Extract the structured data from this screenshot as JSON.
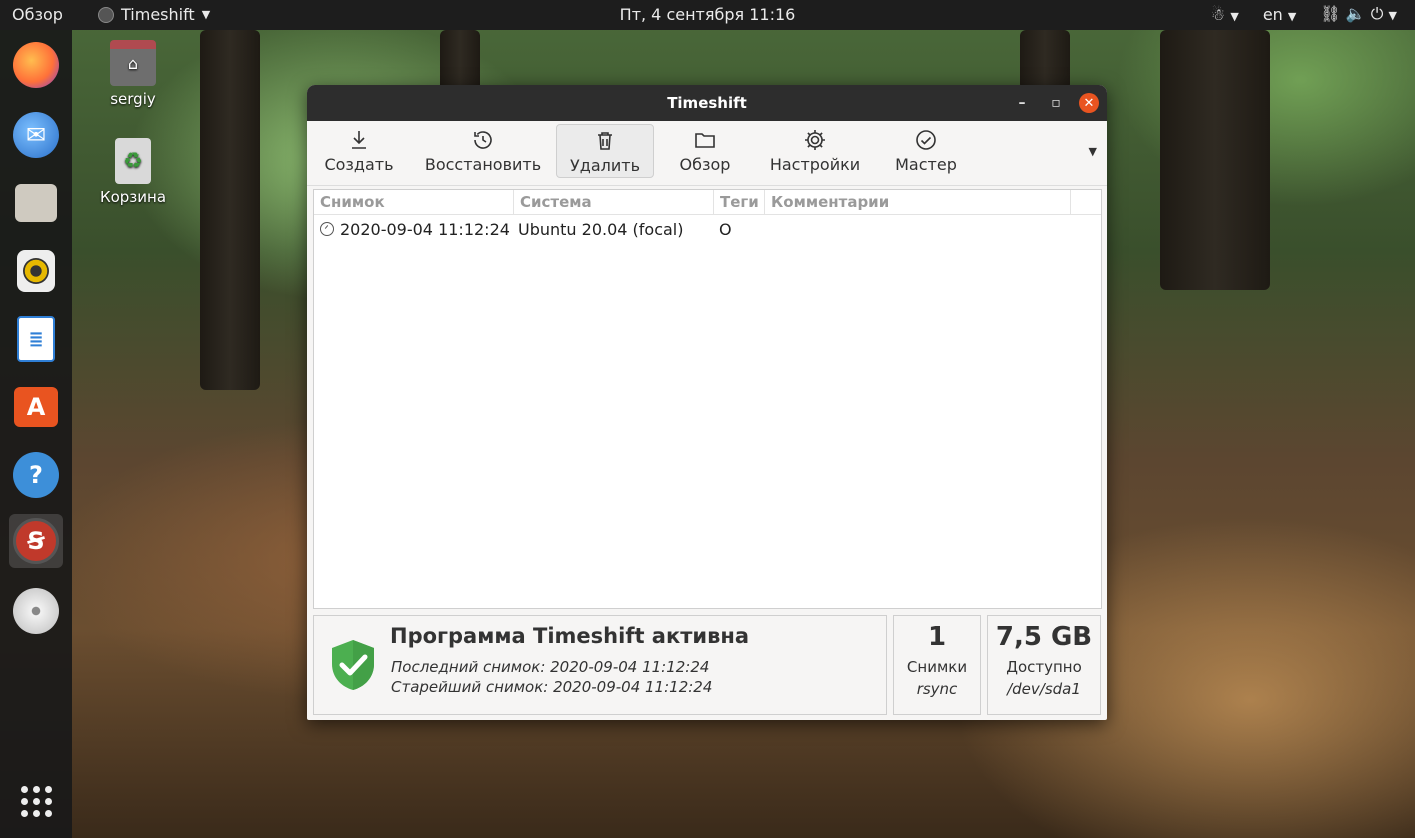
{
  "topbar": {
    "activities": "Обзор",
    "app_name": "Timeshift",
    "clock": "Пт, 4 сентября  11:16",
    "keyboard_layout": "en"
  },
  "dock": {
    "items": [
      {
        "name": "firefox",
        "color": "#ff7139"
      },
      {
        "name": "thunderbird",
        "color": "#2a6fc9"
      },
      {
        "name": "files",
        "color": "#d7d2c9"
      },
      {
        "name": "rhythmbox",
        "color": "#e6b800"
      },
      {
        "name": "libreoffice-writer",
        "color": "#2f7fd6"
      },
      {
        "name": "software",
        "color": "#e95420"
      },
      {
        "name": "help",
        "color": "#3d8fd9"
      },
      {
        "name": "timeshift",
        "color": "#c0392b"
      },
      {
        "name": "dvd",
        "color": "#d9d9d9"
      }
    ]
  },
  "desktop": {
    "home_label": "sergiy",
    "trash_label": "Корзина"
  },
  "window": {
    "title": "Timeshift",
    "toolbar": {
      "create": "Создать",
      "restore": "Восстановить",
      "delete": "Удалить",
      "browse": "Обзор",
      "settings": "Настройки",
      "wizard": "Мастер"
    },
    "table": {
      "columns": [
        "Снимок",
        "Система",
        "Теги",
        "Комментарии"
      ],
      "rows": [
        {
          "snapshot": "2020-09-04 11:12:24",
          "system": "Ubuntu 20.04 (focal)",
          "tags": "O",
          "comments": ""
        }
      ]
    },
    "status": {
      "title": "Программа Timeshift активна",
      "last_snapshot": "Последний снимок: 2020-09-04 11:12:24",
      "oldest_snapshot": "Старейший снимок: 2020-09-04 11:12:24"
    },
    "snapshots": {
      "count": "1",
      "label": "Снимки",
      "sub": "rsync"
    },
    "space": {
      "value": "7,5 GB",
      "label": "Доступно",
      "sub": "/dev/sda1"
    }
  },
  "colors": {
    "accent": "#e95420",
    "shield": "#4caf50"
  }
}
